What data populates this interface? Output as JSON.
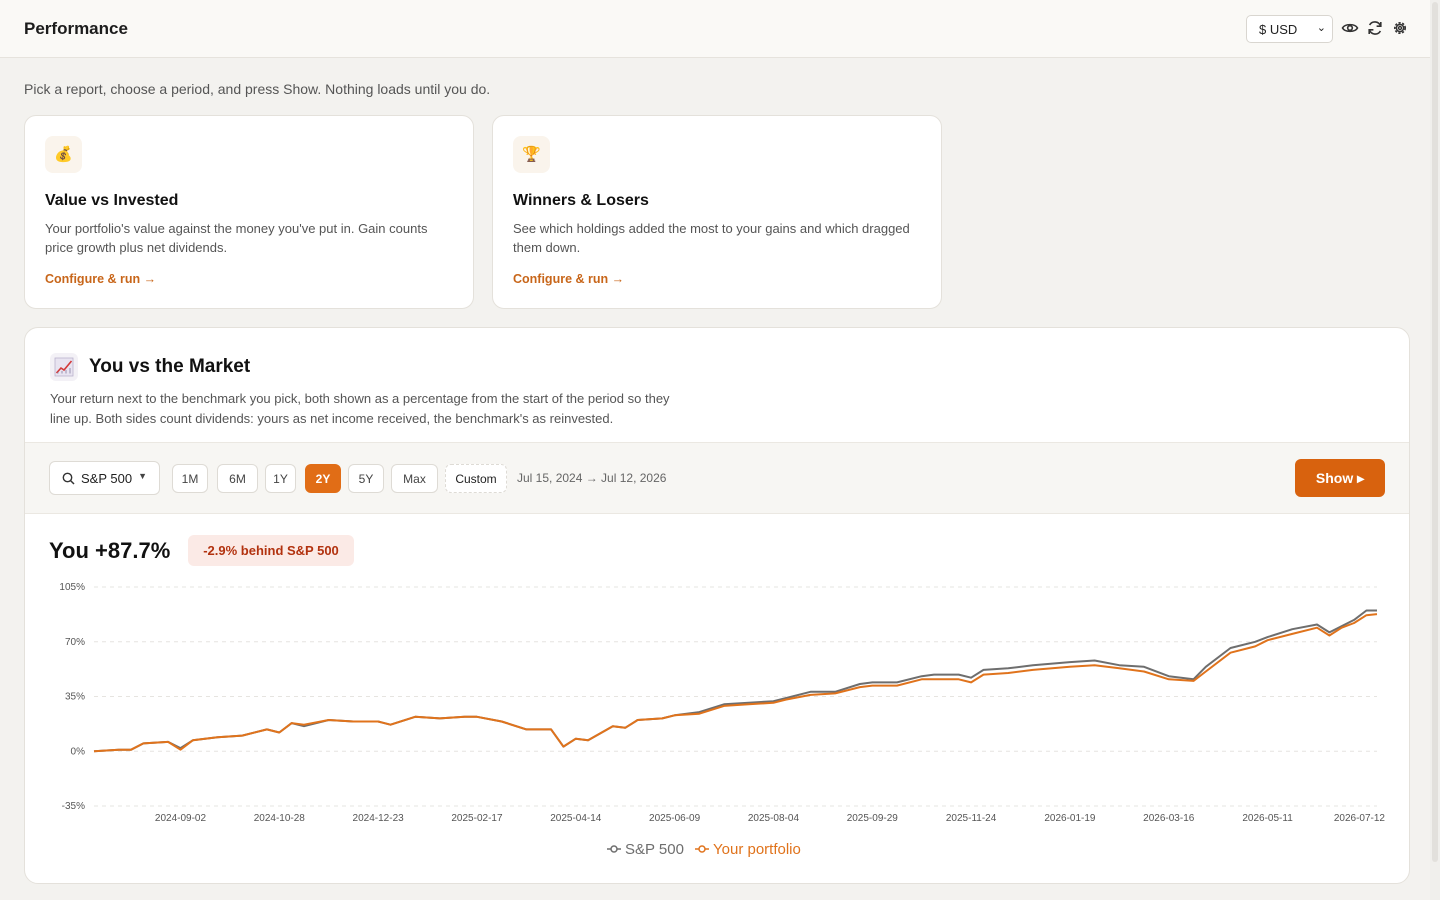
{
  "header": {
    "title": "Performance",
    "currency": "$ USD",
    "icons": [
      "eye-icon",
      "refresh-icon",
      "settings-icon"
    ]
  },
  "intro": "Pick a report, choose a period, and press Show. Nothing loads until you do.",
  "cards": [
    {
      "icon": "money-bag-icon",
      "title": "Value vs Invested",
      "description": "Your portfolio's value against the money you've put in. Gain counts price growth plus net dividends.",
      "link": "Configure & run →"
    },
    {
      "icon": "trophy-icon",
      "title": "Winners & Losers",
      "description": "See which holdings added the most to your gains and which dragged them down.",
      "link": "Configure & run →"
    }
  ],
  "market": {
    "icon": "chart-increasing-icon",
    "title": "You vs the Market",
    "description": "Your return next to the benchmark you pick, both shown as a percentage from the start of the period so they line up. Both sides count dividends: yours as net income received, the benchmark's as reinvested.",
    "benchmark": "S&P 500",
    "periods": [
      "1M",
      "6M",
      "1Y",
      "2Y",
      "5Y",
      "Max",
      "Custom"
    ],
    "active_period": "2Y",
    "range": "Jul 15, 2024 → Jul 12, 2026",
    "show_label": "Show ▸",
    "you_label": "You +87.7%",
    "behind_label": "-2.9% behind S&P 500"
  },
  "colors": {
    "accent": "#e16d16",
    "benchmark_line": "#6e6e6e",
    "portfolio_line": "#e0731c"
  },
  "chart_data": {
    "type": "line",
    "title": "",
    "xlabel": "",
    "ylabel": "",
    "x_range": [
      "2024-07-15",
      "2026-07-12"
    ],
    "ylim": [
      -35,
      105
    ],
    "y_ticks": [
      "105%",
      "70%",
      "35%",
      "0%",
      "-35%"
    ],
    "x_ticks": [
      "2024-09-02",
      "2024-10-28",
      "2024-12-23",
      "2025-02-17",
      "2025-04-14",
      "2025-06-09",
      "2025-08-04",
      "2025-09-29",
      "2025-11-24",
      "2026-01-19",
      "2026-03-16",
      "2026-05-11",
      "2026-07-12"
    ],
    "grid": true,
    "legend": "bottom-center",
    "series": [
      {
        "name": "S&P 500",
        "points": [
          [
            "2024-07-15",
            0
          ],
          [
            "2024-07-29",
            1
          ],
          [
            "2024-08-05",
            1
          ],
          [
            "2024-08-12",
            5
          ],
          [
            "2024-08-26",
            6
          ],
          [
            "2024-09-02",
            2
          ],
          [
            "2024-09-09",
            7
          ],
          [
            "2024-09-23",
            9
          ],
          [
            "2024-10-07",
            10
          ],
          [
            "2024-10-21",
            14
          ],
          [
            "2024-10-28",
            12
          ],
          [
            "2024-11-04",
            18
          ],
          [
            "2024-11-11",
            16
          ],
          [
            "2024-11-25",
            20
          ],
          [
            "2024-12-09",
            19
          ],
          [
            "2024-12-23",
            19
          ],
          [
            "2024-12-30",
            17
          ],
          [
            "2025-01-13",
            22
          ],
          [
            "2025-01-27",
            21
          ],
          [
            "2025-02-10",
            22
          ],
          [
            "2025-02-17",
            22
          ],
          [
            "2025-03-03",
            19
          ],
          [
            "2025-03-17",
            14
          ],
          [
            "2025-03-31",
            14
          ],
          [
            "2025-04-07",
            3
          ],
          [
            "2025-04-14",
            8
          ],
          [
            "2025-04-21",
            7
          ],
          [
            "2025-05-05",
            16
          ],
          [
            "2025-05-12",
            15
          ],
          [
            "2025-05-19",
            20
          ],
          [
            "2025-06-02",
            21
          ],
          [
            "2025-06-09",
            23
          ],
          [
            "2025-06-23",
            25
          ],
          [
            "2025-07-07",
            30
          ],
          [
            "2025-07-21",
            31
          ],
          [
            "2025-08-04",
            32
          ],
          [
            "2025-08-11",
            34
          ],
          [
            "2025-08-25",
            38
          ],
          [
            "2025-09-08",
            38
          ],
          [
            "2025-09-22",
            43
          ],
          [
            "2025-09-29",
            44
          ],
          [
            "2025-10-13",
            44
          ],
          [
            "2025-10-27",
            48
          ],
          [
            "2025-11-03",
            49
          ],
          [
            "2025-11-17",
            49
          ],
          [
            "2025-11-24",
            47
          ],
          [
            "2025-12-01",
            52
          ],
          [
            "2025-12-15",
            53
          ],
          [
            "2025-12-29",
            55
          ],
          [
            "2026-01-19",
            57
          ],
          [
            "2026-02-02",
            58
          ],
          [
            "2026-02-16",
            55
          ],
          [
            "2026-03-02",
            54
          ],
          [
            "2026-03-16",
            48
          ],
          [
            "2026-03-30",
            46
          ],
          [
            "2026-04-06",
            54
          ],
          [
            "2026-04-20",
            66
          ],
          [
            "2026-05-04",
            70
          ],
          [
            "2026-05-11",
            73
          ],
          [
            "2026-05-25",
            78
          ],
          [
            "2026-06-08",
            81
          ],
          [
            "2026-06-15",
            76
          ],
          [
            "2026-06-22",
            80
          ],
          [
            "2026-06-29",
            84
          ],
          [
            "2026-07-06",
            90
          ],
          [
            "2026-07-12",
            90
          ]
        ]
      },
      {
        "name": "Your portfolio",
        "points": [
          [
            "2024-07-15",
            0
          ],
          [
            "2024-07-29",
            1
          ],
          [
            "2024-08-05",
            1
          ],
          [
            "2024-08-12",
            5
          ],
          [
            "2024-08-26",
            6
          ],
          [
            "2024-09-02",
            1
          ],
          [
            "2024-09-09",
            7
          ],
          [
            "2024-09-23",
            9
          ],
          [
            "2024-10-07",
            10
          ],
          [
            "2024-10-21",
            14
          ],
          [
            "2024-10-28",
            12
          ],
          [
            "2024-11-04",
            18
          ],
          [
            "2024-11-11",
            17
          ],
          [
            "2024-11-25",
            20
          ],
          [
            "2024-12-09",
            19
          ],
          [
            "2024-12-23",
            19
          ],
          [
            "2024-12-30",
            17
          ],
          [
            "2025-01-13",
            22
          ],
          [
            "2025-01-27",
            21
          ],
          [
            "2025-02-10",
            22
          ],
          [
            "2025-02-17",
            22
          ],
          [
            "2025-03-03",
            19
          ],
          [
            "2025-03-17",
            14
          ],
          [
            "2025-03-31",
            14
          ],
          [
            "2025-04-07",
            3
          ],
          [
            "2025-04-14",
            8
          ],
          [
            "2025-04-21",
            7
          ],
          [
            "2025-05-05",
            16
          ],
          [
            "2025-05-12",
            15
          ],
          [
            "2025-05-19",
            20
          ],
          [
            "2025-06-02",
            21
          ],
          [
            "2025-06-09",
            23
          ],
          [
            "2025-06-23",
            24
          ],
          [
            "2025-07-07",
            29
          ],
          [
            "2025-07-21",
            30
          ],
          [
            "2025-08-04",
            31
          ],
          [
            "2025-08-11",
            33
          ],
          [
            "2025-08-25",
            36
          ],
          [
            "2025-09-08",
            37
          ],
          [
            "2025-09-22",
            41
          ],
          [
            "2025-09-29",
            42
          ],
          [
            "2025-10-13",
            42
          ],
          [
            "2025-10-27",
            46
          ],
          [
            "2025-11-03",
            46
          ],
          [
            "2025-11-17",
            46
          ],
          [
            "2025-11-24",
            44
          ],
          [
            "2025-12-01",
            49
          ],
          [
            "2025-12-15",
            50
          ],
          [
            "2025-12-29",
            52
          ],
          [
            "2026-01-19",
            54
          ],
          [
            "2026-02-02",
            55
          ],
          [
            "2026-02-16",
            53
          ],
          [
            "2026-03-02",
            51
          ],
          [
            "2026-03-16",
            46
          ],
          [
            "2026-03-30",
            45
          ],
          [
            "2026-04-06",
            51
          ],
          [
            "2026-04-20",
            63
          ],
          [
            "2026-05-04",
            67
          ],
          [
            "2026-05-11",
            71
          ],
          [
            "2026-05-25",
            75
          ],
          [
            "2026-06-08",
            79
          ],
          [
            "2026-06-15",
            74
          ],
          [
            "2026-06-22",
            79
          ],
          [
            "2026-06-29",
            82
          ],
          [
            "2026-07-06",
            87
          ],
          [
            "2026-07-12",
            87.7
          ]
        ]
      }
    ]
  }
}
